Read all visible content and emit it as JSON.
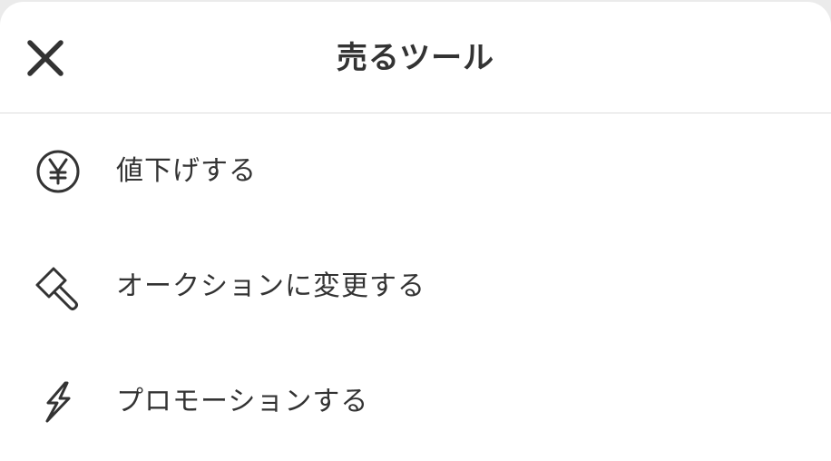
{
  "header": {
    "title": "売るツール",
    "close_icon": "close-icon"
  },
  "menu": {
    "items": [
      {
        "label": "値下げする",
        "icon": "yen-circle-icon"
      },
      {
        "label": "オークションに変更する",
        "icon": "gavel-icon"
      },
      {
        "label": "プロモーションする",
        "icon": "lightning-icon"
      }
    ]
  },
  "colors": {
    "text": "#333333",
    "background": "#ffffff",
    "divider": "#dcdcdc",
    "backdrop": "#ebebeb"
  }
}
